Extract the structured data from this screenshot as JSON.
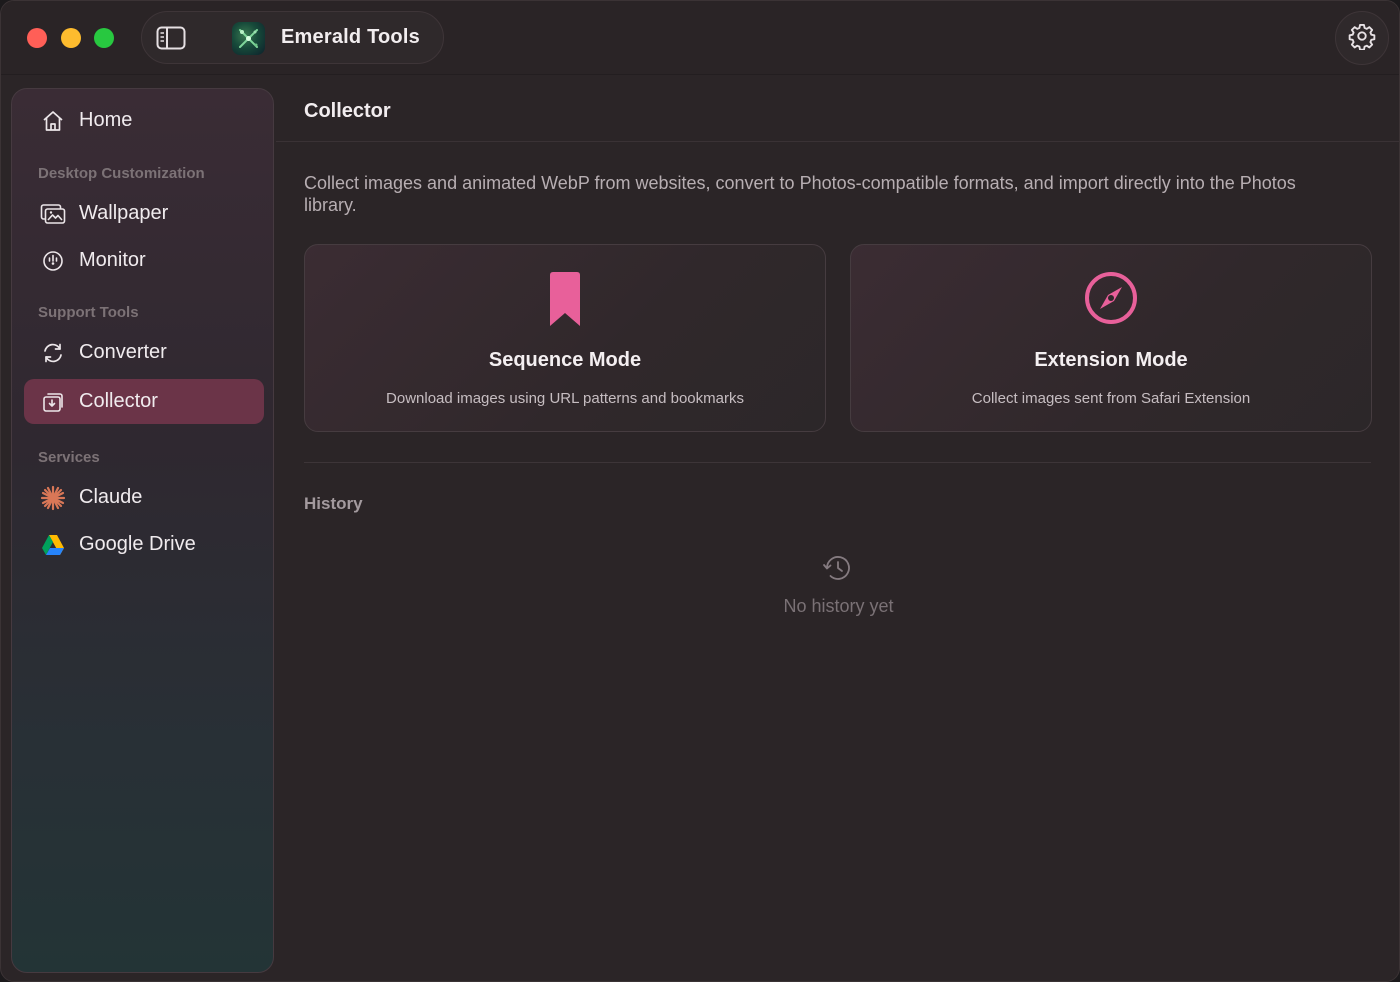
{
  "titlebar": {
    "app_title": "Emerald Tools"
  },
  "sidebar": {
    "home": "Home",
    "sections": [
      {
        "label": "Desktop Customization"
      },
      {
        "label": "Support Tools"
      },
      {
        "label": "Services"
      }
    ],
    "items": {
      "wallpaper": "Wallpaper",
      "monitor": "Monitor",
      "converter": "Converter",
      "collector": "Collector",
      "claude": "Claude",
      "google_drive": "Google Drive"
    },
    "active_item": "Collector"
  },
  "main": {
    "title": "Collector",
    "description": "Collect images and animated WebP from websites, convert to Photos-compatible formats, and import directly into the Photos library.",
    "cards": [
      {
        "icon": "bookmark-icon",
        "title": "Sequence Mode",
        "desc": "Download images using URL patterns and bookmarks"
      },
      {
        "icon": "compass-icon",
        "title": "Extension Mode",
        "desc": "Collect images sent from Safari Extension"
      }
    ],
    "history": {
      "label": "History",
      "empty_text": "No history yet",
      "empty_icon": "history-icon"
    }
  },
  "colors": {
    "accent": "#e8609a",
    "active_bg": "#6b3448",
    "background": "#2b2527"
  }
}
